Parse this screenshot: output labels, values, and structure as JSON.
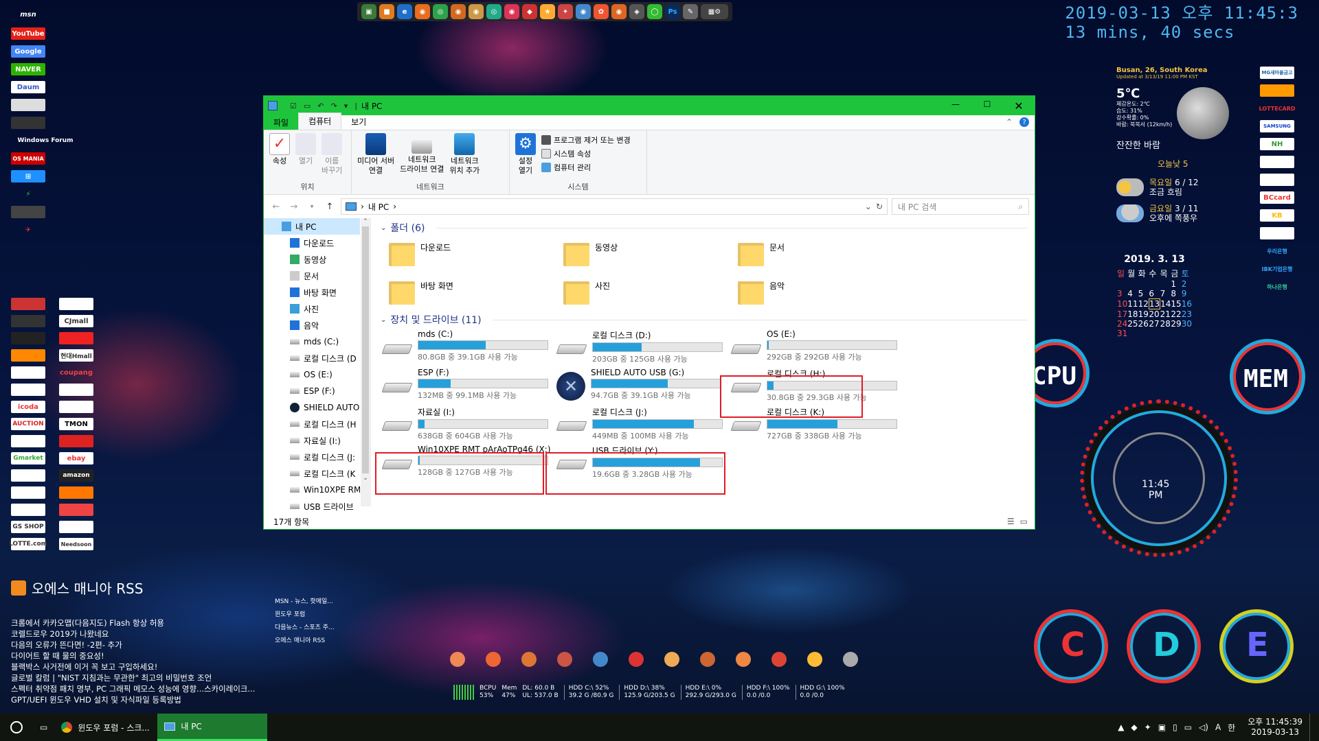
{
  "desktop": {
    "clock": {
      "datetime": "2019-03-13 오후 11:45:3",
      "uptime": "13 mins, 40 secs"
    },
    "weather": {
      "location": "Busan, 26, South Korea",
      "updated": "Updated at 3/13/19 11:00 PM KST",
      "temp": "5℃",
      "details": [
        "체감온도: 2℃",
        "습도: 31%",
        "강수확률: 0%",
        "바람: 북북서 (12km/h)"
      ],
      "condition": "잔잔한 바람",
      "today": "오늘낮 5",
      "forecast": [
        {
          "day": "목요일",
          "range": "6 / 12",
          "cond": "조금 흐림"
        },
        {
          "day": "금요일",
          "range": "3 / 11",
          "cond": "오후에 쪽풍우"
        }
      ]
    },
    "calendar": {
      "title": "2019. 3.  13",
      "weekdays": [
        "일",
        "월",
        "화",
        "수",
        "목",
        "금",
        "토"
      ],
      "weeks": [
        [
          "",
          "",
          "",
          "",
          "",
          "1",
          "2"
        ],
        [
          "3",
          "4",
          "5",
          "6",
          "7",
          "8",
          "9"
        ],
        [
          "10",
          "11",
          "12",
          "13",
          "14",
          "15",
          "16"
        ],
        [
          "17",
          "18",
          "19",
          "20",
          "21",
          "22",
          "23"
        ],
        [
          "24",
          "25",
          "26",
          "27",
          "28",
          "29",
          "30"
        ],
        [
          "31",
          "",
          "",
          "",
          "",
          "",
          ""
        ]
      ],
      "today": "13"
    },
    "gauges": {
      "cpu": "CPU",
      "mem": "MEM",
      "clock": "11:45",
      "ampm": "PM",
      "drives": [
        "C",
        "D",
        "E"
      ]
    },
    "left_icons": [
      "msn",
      "YouTube",
      "Google",
      "NAVER",
      "Daum",
      "",
      "",
      "Windows Forum",
      "OS MANIA",
      "",
      "",
      "",
      "",
      "",
      "",
      "",
      "",
      "",
      "",
      "",
      "",
      "",
      "CJmall",
      "",
      "",
      "",
      "현대Hmall",
      "",
      "coupang",
      "",
      "",
      "icoda",
      "",
      "AUCTION",
      "TMON",
      "",
      "",
      "Gmarket",
      "ebay",
      "",
      "amazon",
      "",
      "",
      "",
      "",
      "GS SHOP",
      "",
      "LOTTE.com",
      "Needsoon"
    ],
    "right_banks": [
      "MG새마을금고",
      "",
      "LOTTECARD",
      "SAMSUNG",
      "NH",
      "",
      "",
      "BCcard",
      "KB",
      "",
      "우리은행",
      "IBK기업은행",
      "하나은행"
    ],
    "rss": {
      "title": "오에스 매니아 RSS",
      "items": [
        "크롬에서 카카오맵(다음지도) Flash 항상 허용",
        "코렐드로우 2019가 나왔네요",
        "다음의 오류가 뜬다면! -2편- 추가",
        "다이어트 할 때 물의 중요성!",
        "블랙박스 사거전에 이거 꼭 보고 구입하세요!",
        "글로벌 칼럼 | \"NIST 지침과는 무관한\" 최고의 비밀번호 조언",
        "스펙터 취약점 패치 명부, PC 그래픽 메모스 성능에 영향...스카이레이크...",
        "GPT/UEFI 윈도우 VHD 설치 및 자식파일 등록방법"
      ],
      "links": [
        "MSN - 뉴스, 핫메일...",
        "윈도우 포럼",
        "다음뉴스 - 스포츠 주...",
        "오에스 매니아 RSS"
      ]
    },
    "sysmon": {
      "bcpu": "BCPU",
      "bcpu_val": "53%",
      "mem": "Mem",
      "mem_val": "47%",
      "dl": "DL:",
      "dl_val": "60.0 B",
      "ul": "UL:",
      "ul_val": "537.0 B",
      "drives": [
        {
          "label": "HDD C:\\",
          "pct": "52%",
          "val": "39.2 G /80.9 G"
        },
        {
          "label": "HDD D:\\",
          "pct": "38%",
          "val": "125.9 G/203.5 G"
        },
        {
          "label": "HDD E:\\",
          "pct": "0%",
          "val": "292.9 G/293.0 G"
        },
        {
          "label": "HDD F:\\",
          "pct": "100%",
          "val": "0.0     /0.0"
        },
        {
          "label": "HDD G:\\",
          "pct": "100%",
          "val": "0.0     /0.0"
        }
      ]
    }
  },
  "window": {
    "title": "내 PC",
    "tabs": [
      "파일",
      "컴퓨터",
      "보기"
    ],
    "ribbon": {
      "groups": [
        {
          "label": "위치",
          "buttons": [
            "속성",
            "열기",
            "이름\n바꾸기"
          ]
        },
        {
          "label": "네트워크",
          "buttons": [
            "미디어 서버\n연결",
            "네트워크\n드라이브 연결",
            "네트워크\n위치 추가"
          ]
        },
        {
          "label": "시스템",
          "big": "설정\n열기",
          "small": [
            "프로그램 제거 또는 변경",
            "시스템 속성",
            "컴퓨터 관리"
          ]
        }
      ]
    },
    "address": {
      "path": "내 PC",
      "search_placeholder": "내 PC 검색"
    },
    "nav": [
      "내 PC",
      "다운로드",
      "동영상",
      "문서",
      "바탕 화면",
      "사진",
      "음악",
      "mds (C:)",
      "로컬 디스크 (D",
      "OS (E:)",
      "ESP (F:)",
      "SHIELD AUTO",
      "로컬 디스크 (H",
      "자료실 (I:)",
      "로컬 디스크 (J:",
      "로컬 디스크 (K",
      "Win10XPE RM",
      "USB 드라이브"
    ],
    "folders_header": "폴더 (6)",
    "folders": [
      "다운로드",
      "동영상",
      "문서",
      "바탕 화면",
      "사진",
      "음악"
    ],
    "drives_header": "장치 및 드라이브 (11)",
    "drives": [
      {
        "name": "mds (C:)",
        "sub": "80.8GB 중 39.1GB 사용 가능",
        "used": 0.52
      },
      {
        "name": "로컬 디스크 (D:)",
        "sub": "203GB 중 125GB 사용 가능",
        "used": 0.38
      },
      {
        "name": "OS (E:)",
        "sub": "292GB 중 292GB 사용 가능",
        "used": 0.003
      },
      {
        "name": "ESP (F:)",
        "sub": "132MB 중 99.1MB 사용 가능",
        "used": 0.25
      },
      {
        "name": "SHIELD AUTO USB (G:)",
        "sub": "94.7GB 중 39.1GB 사용 가능",
        "used": 0.59
      },
      {
        "name": "로컬 디스크 (H:)",
        "sub": "30.8GB 중 29.3GB 사용 가능",
        "used": 0.05
      },
      {
        "name": "자료실 (I:)",
        "sub": "638GB 중 604GB 사용 가능",
        "used": 0.05
      },
      {
        "name": "로컬 디스크 (J:)",
        "sub": "449MB 중 100MB 사용 가능",
        "used": 0.78
      },
      {
        "name": "로컬 디스크 (K:)",
        "sub": "727GB 중 338GB 사용 가능",
        "used": 0.54
      },
      {
        "name": "Win10XPE RMT pArAoTPg46 (X:)",
        "sub": "128GB 중 127GB 사용 가능",
        "used": 0.01
      },
      {
        "name": "USB 드라이브 (Y:)",
        "sub": "19.6GB 중 3.28GB 사용 가능",
        "used": 0.83
      }
    ],
    "status": "17개 항목"
  },
  "taskbar": {
    "items": [
      "윈도우 포럼 - 스크...",
      "내 PC"
    ],
    "time": "오후 11:45:39",
    "date": "2019-03-13"
  }
}
